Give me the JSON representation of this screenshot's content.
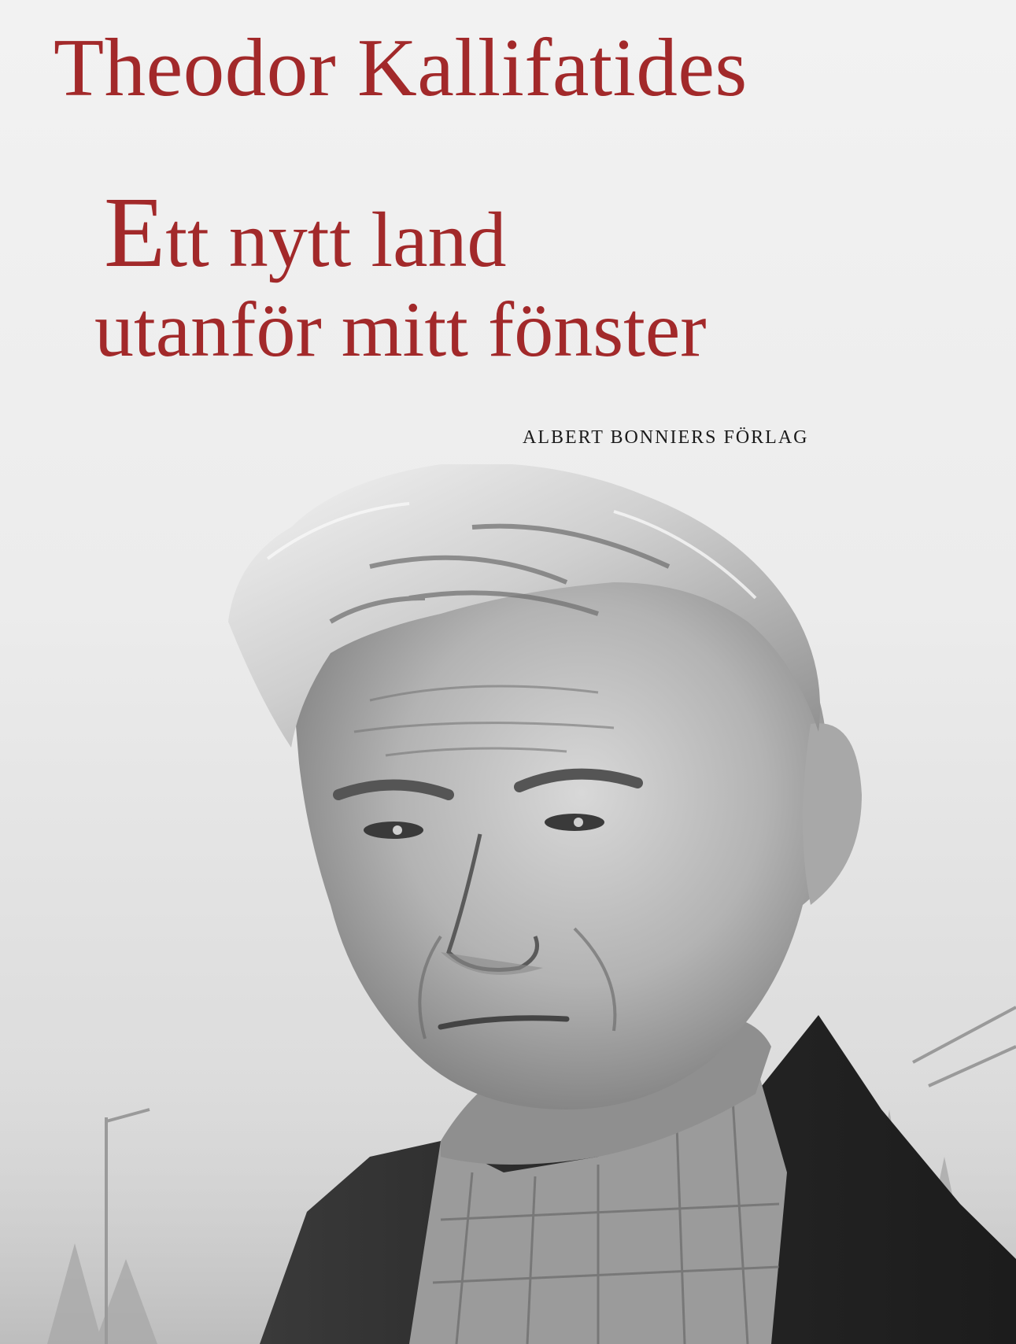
{
  "cover": {
    "author": "Theodor Kallifatides",
    "title_initial": "E",
    "title_line1_rest": "tt nytt land",
    "title_line2": "utanför mitt fönster",
    "publisher": "ALBERT BONNIERS FÖRLAG"
  },
  "colors": {
    "title_red": "#a2292a",
    "background": "#ebebeb"
  }
}
